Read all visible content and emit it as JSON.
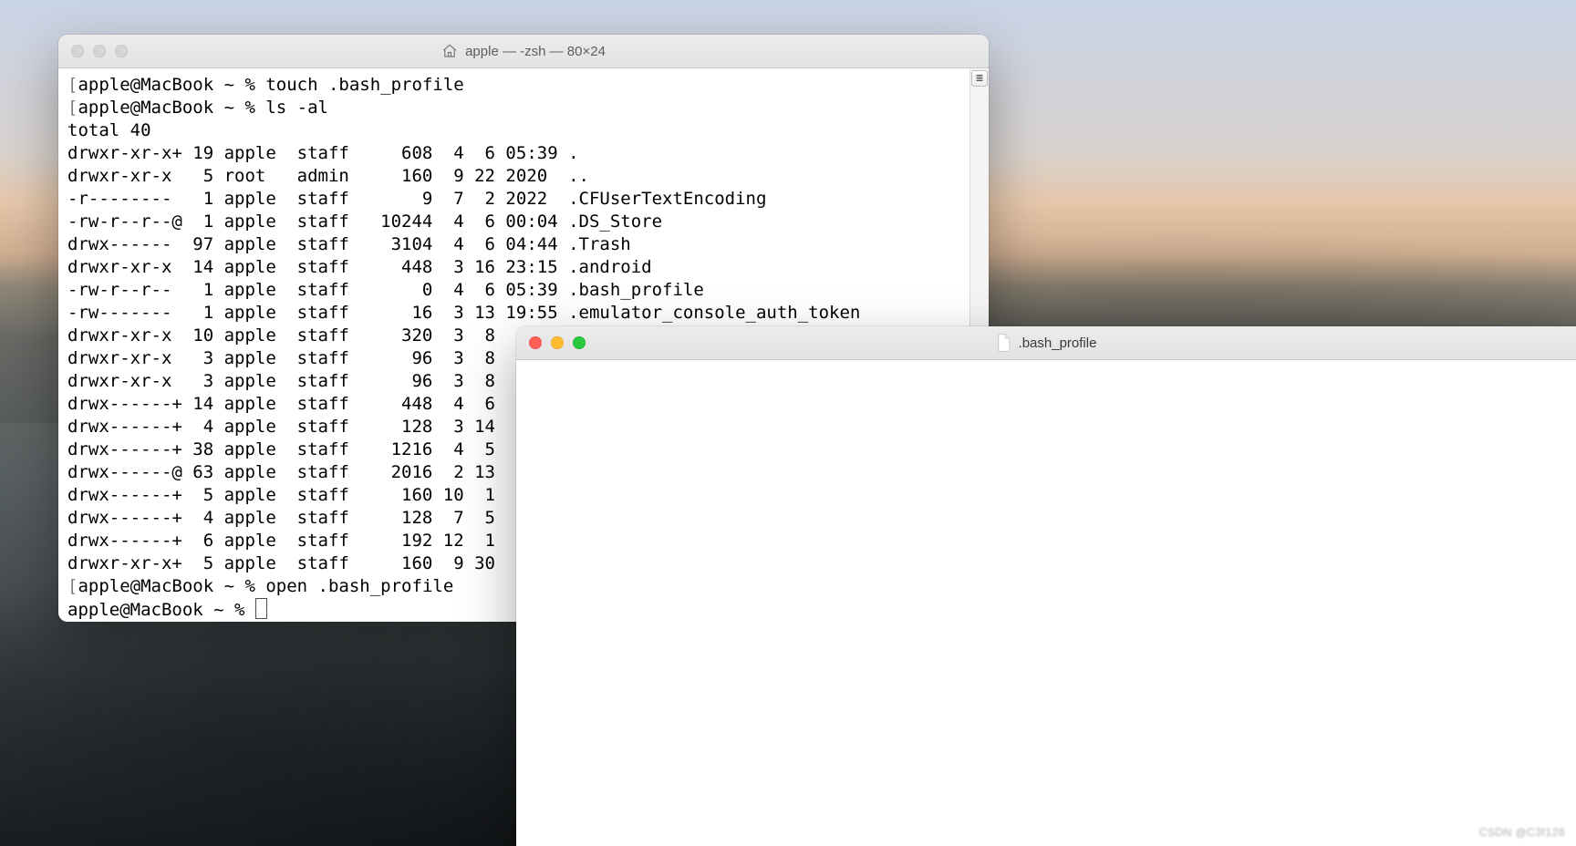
{
  "terminal": {
    "title": "apple — -zsh — 80×24",
    "prompt_user_host": "apple@MacBook",
    "prompt_path": "~",
    "prompt_symbol": "%",
    "commands": {
      "c1": "touch .bash_profile",
      "c2": "ls -al",
      "c3": "open .bash_profile",
      "c4": ""
    },
    "ls_header": "total 40",
    "rows": [
      {
        "perm": "drwxr-xr-x+",
        "links": "19",
        "owner": "apple",
        "group": "staff",
        "size": "608",
        "m": "4",
        "d": "6",
        "time": "05:39",
        "name": "."
      },
      {
        "perm": "drwxr-xr-x ",
        "links": "5",
        "owner": "root",
        "group": "admin",
        "size": "160",
        "m": "9",
        "d": "22",
        "time": "2020",
        "name": ".."
      },
      {
        "perm": "-r--------",
        "links": "1",
        "owner": "apple",
        "group": "staff",
        "size": "9",
        "m": "7",
        "d": "2",
        "time": "2022",
        "name": ".CFUserTextEncoding"
      },
      {
        "perm": "-rw-r--r--@",
        "links": "1",
        "owner": "apple",
        "group": "staff",
        "size": "10244",
        "m": "4",
        "d": "6",
        "time": "00:04",
        "name": ".DS_Store"
      },
      {
        "perm": "drwx------",
        "links": "97",
        "owner": "apple",
        "group": "staff",
        "size": "3104",
        "m": "4",
        "d": "6",
        "time": "04:44",
        "name": ".Trash"
      },
      {
        "perm": "drwxr-xr-x",
        "links": "14",
        "owner": "apple",
        "group": "staff",
        "size": "448",
        "m": "3",
        "d": "16",
        "time": "23:15",
        "name": ".android"
      },
      {
        "perm": "-rw-r--r--",
        "links": "1",
        "owner": "apple",
        "group": "staff",
        "size": "0",
        "m": "4",
        "d": "6",
        "time": "05:39",
        "name": ".bash_profile"
      },
      {
        "perm": "-rw-------",
        "links": "1",
        "owner": "apple",
        "group": "staff",
        "size": "16",
        "m": "3",
        "d": "13",
        "time": "19:55",
        "name": ".emulator_console_auth_token"
      },
      {
        "perm": "drwxr-xr-x",
        "links": "10",
        "owner": "apple",
        "group": "staff",
        "size": "320",
        "m": "3",
        "d": "8",
        "time": "",
        "name": ""
      },
      {
        "perm": "drwxr-xr-x",
        "links": "3",
        "owner": "apple",
        "group": "staff",
        "size": "96",
        "m": "3",
        "d": "8",
        "time": "",
        "name": ""
      },
      {
        "perm": "drwxr-xr-x",
        "links": "3",
        "owner": "apple",
        "group": "staff",
        "size": "96",
        "m": "3",
        "d": "8",
        "time": "",
        "name": ""
      },
      {
        "perm": "drwx------+",
        "links": "14",
        "owner": "apple",
        "group": "staff",
        "size": "448",
        "m": "4",
        "d": "6",
        "time": "",
        "name": ""
      },
      {
        "perm": "drwx------+",
        "links": "4",
        "owner": "apple",
        "group": "staff",
        "size": "128",
        "m": "3",
        "d": "14",
        "time": "",
        "name": ""
      },
      {
        "perm": "drwx------+",
        "links": "38",
        "owner": "apple",
        "group": "staff",
        "size": "1216",
        "m": "4",
        "d": "5",
        "time": "",
        "name": ""
      },
      {
        "perm": "drwx------@",
        "links": "63",
        "owner": "apple",
        "group": "staff",
        "size": "2016",
        "m": "2",
        "d": "13",
        "time": "",
        "name": ""
      },
      {
        "perm": "drwx------+",
        "links": "5",
        "owner": "apple",
        "group": "staff",
        "size": "160",
        "m": "10",
        "d": "1",
        "time": "",
        "name": ""
      },
      {
        "perm": "drwx------+",
        "links": "4",
        "owner": "apple",
        "group": "staff",
        "size": "128",
        "m": "7",
        "d": "5",
        "time": "",
        "name": ""
      },
      {
        "perm": "drwx------+",
        "links": "6",
        "owner": "apple",
        "group": "staff",
        "size": "192",
        "m": "12",
        "d": "1",
        "time": "",
        "name": ""
      },
      {
        "perm": "drwxr-xr-x+",
        "links": "5",
        "owner": "apple",
        "group": "staff",
        "size": "160",
        "m": "9",
        "d": "30",
        "time": "",
        "name": ""
      }
    ]
  },
  "editor": {
    "title": ".bash_profile"
  },
  "watermark": "CSDN @C3f128"
}
